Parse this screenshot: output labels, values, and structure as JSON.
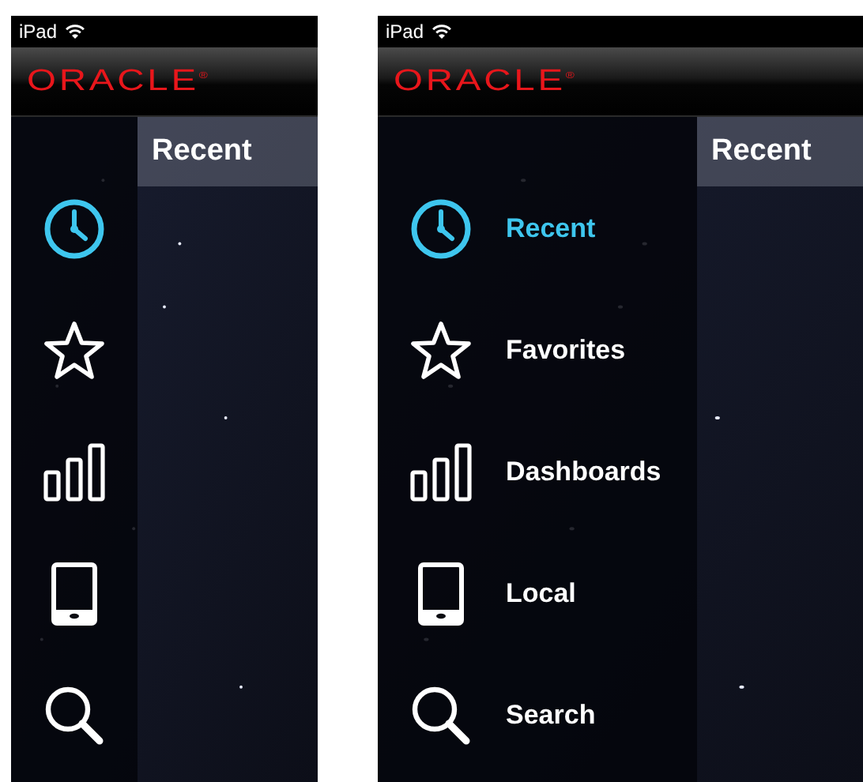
{
  "screens": [
    {
      "status_bar": {
        "device": "iPad"
      },
      "logo": "ORACLE$^{®}$",
      "sidebar_expanded": false,
      "panel_title": "Recent",
      "menu": [
        {
          "kind": "clock",
          "selected": true
        },
        {
          "kind": "star",
          "selected": false
        },
        {
          "kind": "bars",
          "selected": false
        },
        {
          "kind": "tablet",
          "selected": false
        },
        {
          "kind": "search",
          "selected": false
        }
      ]
    },
    {
      "status_bar": {
        "device": "iPad"
      },
      "logo": "ORACLE$^{®}$",
      "sidebar_expanded": true,
      "panel_title": "Recent",
      "menu": [
        {
          "kind": "clock",
          "label": "Recent",
          "selected": true
        },
        {
          "kind": "star",
          "label": "Favorites",
          "selected": false
        },
        {
          "kind": "bars",
          "label": "Dashboards",
          "selected": false
        },
        {
          "kind": "tablet",
          "label": "Local",
          "selected": false
        },
        {
          "kind": "search",
          "label": "Search",
          "selected": false
        }
      ]
    }
  ]
}
